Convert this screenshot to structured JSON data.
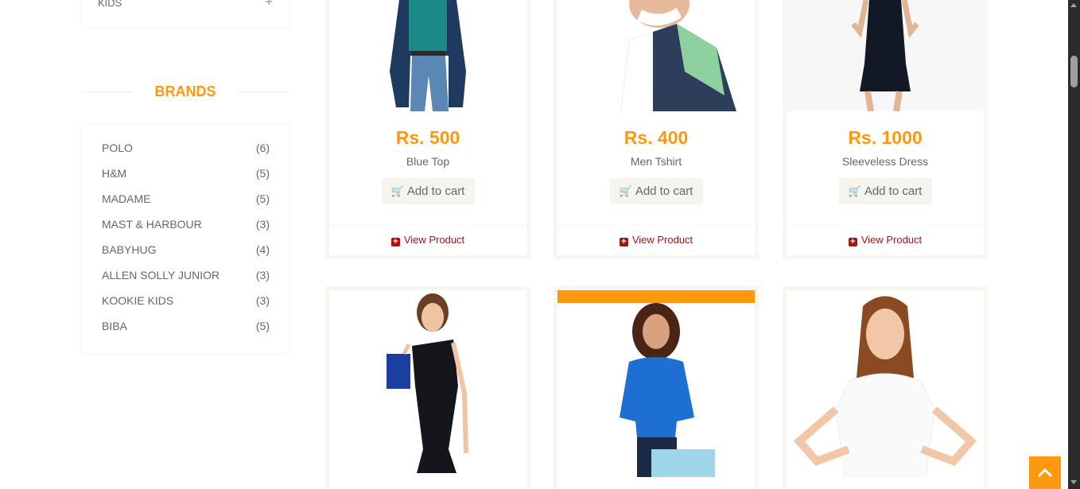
{
  "sidebar": {
    "category_last": "KIDS",
    "brands_title": "BRANDS",
    "brands": [
      {
        "name": "POLO",
        "count": "(6)"
      },
      {
        "name": "H&M",
        "count": "(5)"
      },
      {
        "name": "MADAME",
        "count": "(5)"
      },
      {
        "name": "MAST & HARBOUR",
        "count": "(3)"
      },
      {
        "name": "BABYHUG",
        "count": "(4)"
      },
      {
        "name": "ALLEN SOLLY JUNIOR",
        "count": "(3)"
      },
      {
        "name": "KOOKIE KIDS",
        "count": "(3)"
      },
      {
        "name": "BIBA",
        "count": "(5)"
      }
    ]
  },
  "products": [
    {
      "price": "Rs. 500",
      "name": "Blue Top",
      "cart_label": "Add to cart",
      "view_label": "View Product"
    },
    {
      "price": "Rs. 400",
      "name": "Men Tshirt",
      "cart_label": "Add to cart",
      "view_label": "View Product"
    },
    {
      "price": "Rs. 1000",
      "name": "Sleeveless Dress",
      "cart_label": "Add to cart",
      "view_label": "View Product"
    }
  ],
  "colors": {
    "accent": "#FE980F",
    "link": "#B0100F",
    "text": "#696763"
  },
  "icons": {
    "plus": "plus-icon",
    "cart": "shopping-cart-icon",
    "view": "plus-square-icon",
    "scroll_top": "chevron-up-icon"
  }
}
